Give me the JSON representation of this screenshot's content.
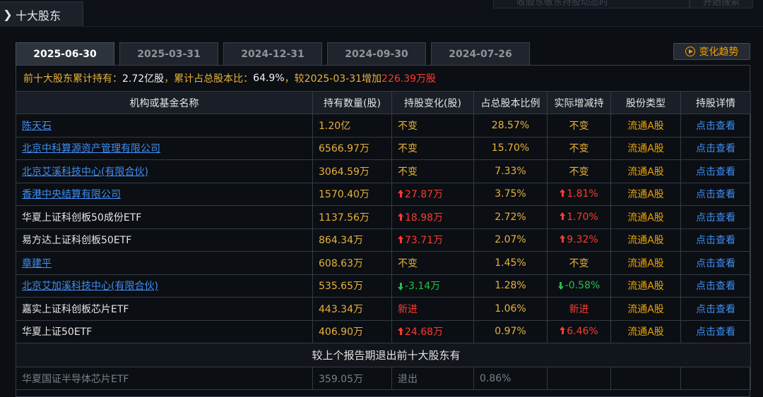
{
  "header": {
    "title": "十大股东"
  },
  "search": {
    "placeholder": "收股东敬东持股动态时",
    "button": "开始搜索"
  },
  "tabs": [
    "2025-06-30",
    "2025-03-31",
    "2024-12-31",
    "2024-09-30",
    "2024-07-26"
  ],
  "active_tab": 0,
  "trend_button": "变化趋势",
  "summary": {
    "prefix": "前十大股东累计持有：",
    "shares": "2.72亿股",
    "mid": "，累计占总股本比：",
    "ratio": "64.9%",
    "compare": "，较2025-03-31增加",
    "increase": "226.39万股"
  },
  "columns": [
    "机构或基金名称",
    "持有数量(股)",
    "持股变化(股)",
    "占总股本比例",
    "实际增减持",
    "股份类型",
    "持股详情"
  ],
  "rows": [
    {
      "name": "陈天石",
      "link": true,
      "qty": "1.20亿",
      "change": "不变",
      "change_dir": "none",
      "ratio": "28.57%",
      "actual": "不变",
      "actual_dir": "none",
      "type": "流通A股",
      "detail": "点击查看"
    },
    {
      "name": "北京中科算源资产管理有限公司",
      "link": true,
      "qty": "6566.97万",
      "change": "不变",
      "change_dir": "none",
      "ratio": "15.70%",
      "actual": "不变",
      "actual_dir": "none",
      "type": "流通A股",
      "detail": "点击查看"
    },
    {
      "name": "北京艾溪科技中心(有限合伙)",
      "link": true,
      "qty": "3064.59万",
      "change": "不变",
      "change_dir": "none",
      "ratio": "7.33%",
      "actual": "不变",
      "actual_dir": "none",
      "type": "流通A股",
      "detail": "点击查看"
    },
    {
      "name": "香港中央结算有限公司",
      "link": true,
      "qty": "1570.40万",
      "change": "27.87万",
      "change_dir": "up",
      "ratio": "3.75%",
      "actual": "1.81%",
      "actual_dir": "up",
      "type": "流通A股",
      "detail": "点击查看"
    },
    {
      "name": "华夏上证科创板50成份ETF",
      "link": false,
      "qty": "1137.56万",
      "change": "18.98万",
      "change_dir": "up",
      "ratio": "2.72%",
      "actual": "1.70%",
      "actual_dir": "up",
      "type": "流通A股",
      "detail": "点击查看"
    },
    {
      "name": "易方达上证科创板50ETF",
      "link": false,
      "qty": "864.34万",
      "change": "73.71万",
      "change_dir": "up",
      "ratio": "2.07%",
      "actual": "9.32%",
      "actual_dir": "up",
      "type": "流通A股",
      "detail": "点击查看"
    },
    {
      "name": "章建平",
      "link": true,
      "qty": "608.63万",
      "change": "不变",
      "change_dir": "none",
      "ratio": "1.45%",
      "actual": "不变",
      "actual_dir": "none",
      "type": "流通A股",
      "detail": "点击查看"
    },
    {
      "name": "北京艾加溪科技中心(有限合伙)",
      "link": true,
      "qty": "535.65万",
      "change": "-3.14万",
      "change_dir": "down",
      "ratio": "1.28%",
      "actual": "-0.58%",
      "actual_dir": "down",
      "type": "流通A股",
      "detail": "点击查看"
    },
    {
      "name": "嘉实上证科创板芯片ETF",
      "link": false,
      "qty": "443.34万",
      "change": "新进",
      "change_dir": "new",
      "ratio": "1.06%",
      "actual": "新进",
      "actual_dir": "new",
      "type": "流通A股",
      "detail": "点击查看"
    },
    {
      "name": "华夏上证50ETF",
      "link": false,
      "qty": "406.90万",
      "change": "24.68万",
      "change_dir": "up",
      "ratio": "0.97%",
      "actual": "6.46%",
      "actual_dir": "up",
      "type": "流通A股",
      "detail": "点击查看"
    }
  ],
  "exit_title": "较上个报告期退出前十大股东有",
  "exit_rows": [
    {
      "name": "华夏国证半导体芯片ETF",
      "qty": "359.05万",
      "change": "退出",
      "ratio": "0.86%",
      "actual": "",
      "type": "",
      "detail": ""
    }
  ],
  "colors": {
    "accent": "#e9b23a",
    "up": "#ff3a2e",
    "down": "#21c248",
    "link": "#3f8ff2"
  }
}
